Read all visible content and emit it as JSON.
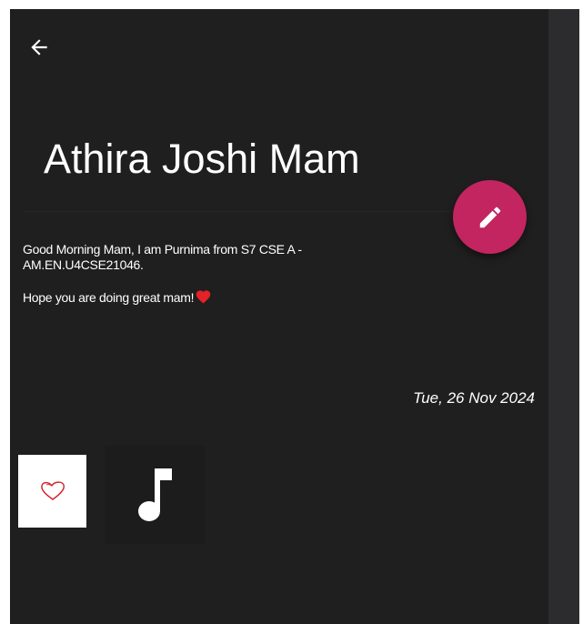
{
  "note": {
    "title": "Athira Joshi Mam",
    "body_line_1": "Good Morning Mam, I am Purnima from S7 CSE A - AM.EN.U4CSE21046.",
    "body_line_2": "Hope you are doing great mam!",
    "date": "Tue, 26 Nov 2024"
  },
  "icons": {
    "back": "arrow-left-icon",
    "edit": "pencil-icon",
    "image_attachment": "heart-drawing",
    "audio_attachment": "music-note-icon",
    "emoji": "red-heart-emoji"
  },
  "colors": {
    "background": "#1f1f1f",
    "fab": "#c2255f",
    "text": "#ffffff",
    "heart": "#e5212a",
    "side_strip": "#2c2c2f"
  }
}
